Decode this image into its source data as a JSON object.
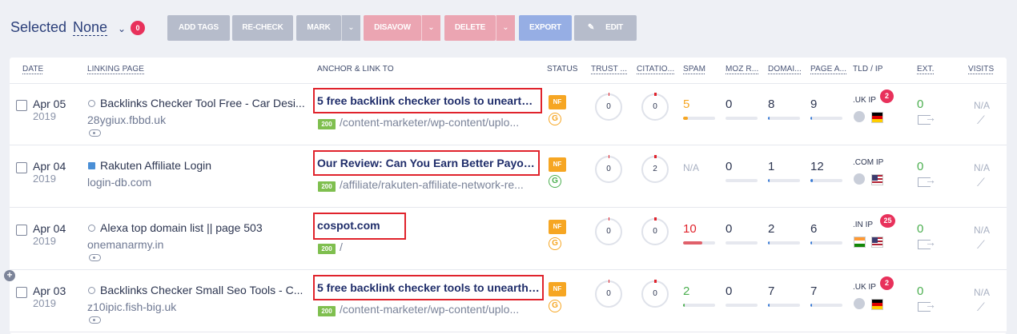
{
  "toolbar": {
    "selected_label": "Selected",
    "selected_value": "None",
    "selected_count": "0",
    "buttons": {
      "add_tags": "ADD TAGS",
      "recheck": "RE-CHECK",
      "mark": "MARK",
      "disavow": "DISAVOW",
      "delete": "DELETE",
      "export": "EXPORT",
      "edit": "EDIT"
    }
  },
  "columns": {
    "date": "DATE",
    "linking_page": "LINKING PAGE",
    "anchor": "ANCHOR & LINK TO",
    "status": "STATUS",
    "trust": "TRUST ...",
    "citation": "CITATIO...",
    "spam": "SPAM",
    "moz": "MOZ R...",
    "domain": "DOMAI...",
    "page": "PAGE A...",
    "tld": "TLD / IP",
    "ext": "EXT.",
    "visits": "VISITS"
  },
  "rows": [
    {
      "date": "Apr 05",
      "year": "2019",
      "title": "Backlinks Checker Tool Free - Car Desi...",
      "domain": "28ygiux.fbbd.uk",
      "anchor": "5 free backlink checker tools to unearth ...",
      "code": "200",
      "link_to": "/content-marketer/wp-content/uplo...",
      "nofollow": "NF",
      "g": "G",
      "g_color": "orange",
      "trust": "0",
      "citation": "0",
      "spam": "5",
      "spam_pct": 0.15,
      "moz": "0",
      "moz_pct": 0,
      "domain_auth": "8",
      "domain_pct": 0.05,
      "page_auth": "9",
      "page_pct": 0.06,
      "tld": ".UK",
      "ip": "IP",
      "ip_count": "2",
      "flags": [
        "world",
        "de"
      ],
      "ext": "0",
      "visits": "N/A",
      "trend": "⟋"
    },
    {
      "date": "Apr 04",
      "year": "2019",
      "title": "Rakuten Affiliate Login",
      "domain": "login-db.com",
      "anchor": "Our Review: Can You Earn Better Payout...",
      "code": "200",
      "link_to": "/affiliate/rakuten-affiliate-network-re...",
      "nofollow": "NF",
      "g": "G",
      "g_color": "green",
      "trust": "0",
      "citation": "2",
      "spam": "N/A",
      "spam_pct": 0,
      "moz": "0",
      "moz_pct": 0,
      "domain_auth": "1",
      "domain_pct": 0.02,
      "page_auth": "12",
      "page_pct": 0.08,
      "tld": ".COM",
      "ip": "IP",
      "ip_count": "",
      "flags": [
        "world",
        "us"
      ],
      "ext": "0",
      "visits": "N/A",
      "trend": "⟋"
    },
    {
      "date": "Apr 04",
      "year": "2019",
      "title": "Alexa top domain list || page 503",
      "domain": "onemanarmy.in",
      "anchor": "cospot.com",
      "code": "200",
      "link_to": "/",
      "nofollow": "NF",
      "g": "G",
      "g_color": "orange",
      "trust": "0",
      "citation": "0",
      "spam": "10",
      "spam_pct": 0.6,
      "moz": "0",
      "moz_pct": 0,
      "domain_auth": "2",
      "domain_pct": 0.03,
      "page_auth": "6",
      "page_pct": 0.05,
      "tld": ".IN",
      "ip": "IP",
      "ip_count": "25",
      "flags": [
        "in",
        "us"
      ],
      "ext": "0",
      "visits": "N/A",
      "trend": "⟋"
    },
    {
      "date": "Apr 03",
      "year": "2019",
      "title": "Backlinks Checker Small Seo Tools - C...",
      "domain": "z10ipic.fish-big.uk",
      "anchor": "5 free backlink checker tools to unearth ...",
      "code": "200",
      "link_to": "/content-marketer/wp-content/uplo...",
      "nofollow": "NF",
      "g": "G",
      "g_color": "orange",
      "trust": "0",
      "citation": "0",
      "spam": "2",
      "spam_pct": 0.05,
      "moz": "0",
      "moz_pct": 0,
      "domain_auth": "7",
      "domain_pct": 0.05,
      "page_auth": "7",
      "page_pct": 0.05,
      "tld": ".UK",
      "ip": "IP",
      "ip_count": "2",
      "flags": [
        "world",
        "de"
      ],
      "ext": "0",
      "visits": "N/A",
      "trend": "⟋"
    }
  ],
  "expand_button": "+"
}
